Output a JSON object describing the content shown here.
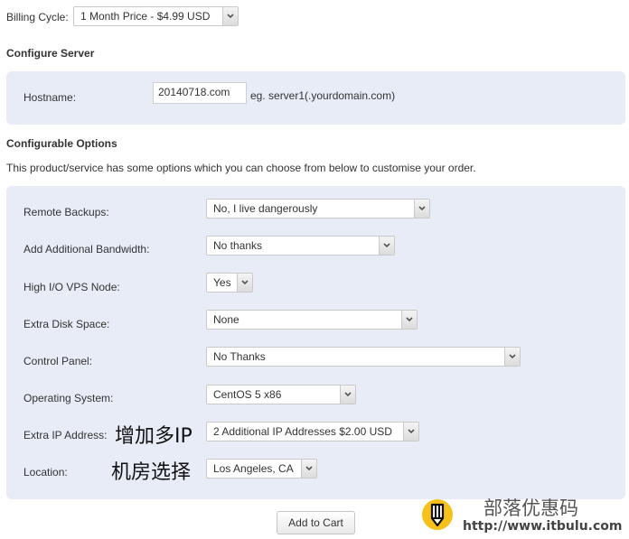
{
  "billing": {
    "label": "Billing Cycle:",
    "selected": "1 Month Price - $4.99 USD"
  },
  "configure_server": {
    "heading": "Configure Server",
    "hostname_label": "Hostname:",
    "hostname_value": "20140718.com",
    "hostname_hint": "eg. server1(.yourdomain.com)"
  },
  "configurable_options": {
    "heading": "Configurable Options",
    "description": "This product/service has some options which you can choose from below to customise your order.",
    "options": [
      {
        "label": "Remote Backups:",
        "selected": "No, I live dangerously"
      },
      {
        "label": "Add Additional Bandwidth:",
        "selected": "No thanks"
      },
      {
        "label": "High I/O VPS Node:",
        "selected": "Yes"
      },
      {
        "label": "Extra Disk Space:",
        "selected": "None"
      },
      {
        "label": "Control Panel:",
        "selected": "No Thanks"
      },
      {
        "label": "Operating System:",
        "selected": "CentOS 5 x86"
      },
      {
        "label": "Extra IP Address:",
        "selected": "2 Additional IP Addresses $2.00 USD",
        "annotation": "增加多IP"
      },
      {
        "label": "Location:",
        "selected": "Los Angeles, CA",
        "annotation": "机房选择"
      }
    ]
  },
  "actions": {
    "add_to_cart": "Add to Cart"
  },
  "watermark": {
    "title": "部落优惠码",
    "url": "http://www.itbulu.com",
    "icon": "pencil-icon",
    "icon_color": "#f5c11a"
  }
}
